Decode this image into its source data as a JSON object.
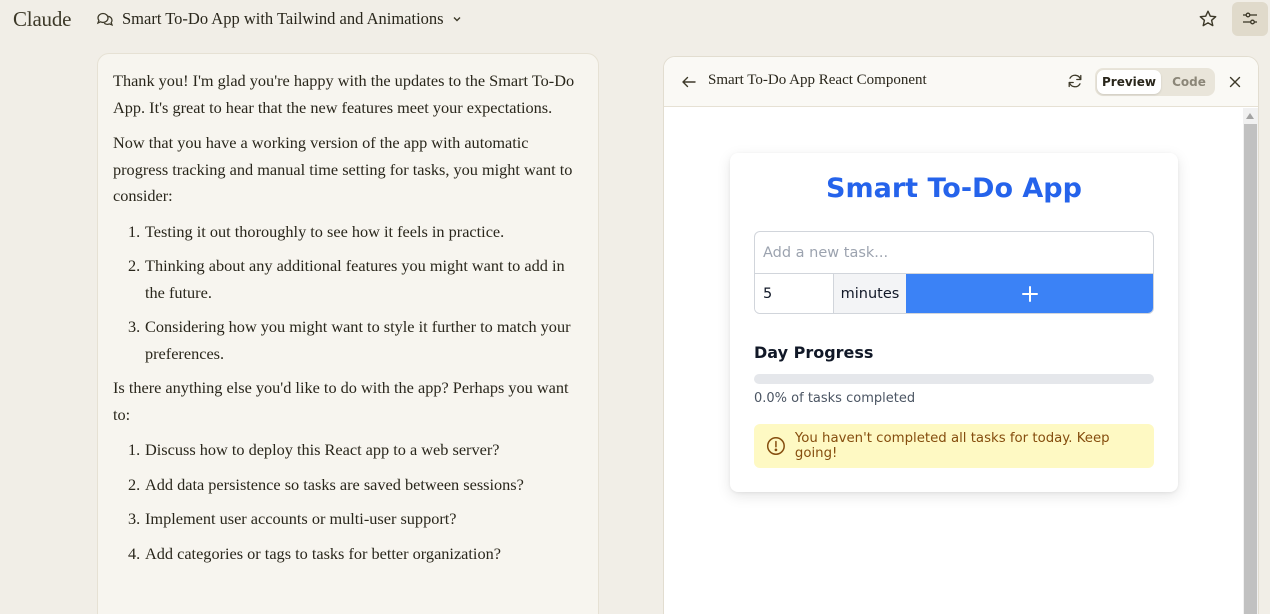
{
  "app": {
    "brand": "Claude",
    "chat_title": "Smart To-Do App with Tailwind and Animations"
  },
  "message": {
    "p1": "Thank you! I'm glad you're happy with the updates to the Smart To-Do App. It's great to hear that the new features meet your expectations.",
    "p2": "Now that you have a working version of the app with automatic progress tracking and manual time setting for tasks, you might want to consider:",
    "list1": [
      {
        "num": "1.",
        "text": "Testing it out thoroughly to see how it feels in practice."
      },
      {
        "num": "2.",
        "text": "Thinking about any additional features you might want to add in the future."
      },
      {
        "num": "3.",
        "text": "Considering how you might want to style it further to match your preferences."
      }
    ],
    "p3": "Is there anything else you'd like to do with the app? Perhaps you want to:",
    "list2": [
      {
        "num": "1.",
        "text": "Discuss how to deploy this React app to a web server?"
      },
      {
        "num": "2.",
        "text": "Add data persistence so tasks are saved between sessions?"
      },
      {
        "num": "3.",
        "text": "Implement user accounts or multi-user support?"
      },
      {
        "num": "4.",
        "text": "Add categories or tags to tasks for better organization?"
      }
    ]
  },
  "artifact": {
    "title": "Smart To-Do App React Component",
    "preview_label": "Preview",
    "code_label": "Code",
    "active_tab": "Preview"
  },
  "todo": {
    "title": "Smart To-Do App",
    "task_placeholder": "Add a new task...",
    "minutes_value": "5",
    "minutes_label": "minutes",
    "add_icon": "plus-icon",
    "progress_heading": "Day Progress",
    "progress_percent": 0,
    "progress_text": "0.0% of tasks completed",
    "alert_text": "You haven't completed all tasks for today. Keep going!",
    "alert_icon": "alert-circle-icon"
  },
  "colors": {
    "accent_blue": "#3b82f6",
    "title_blue": "#2563eb",
    "alert_bg": "#fef9c3",
    "alert_text": "#854d0e",
    "page_bg": "#f1eee7"
  }
}
